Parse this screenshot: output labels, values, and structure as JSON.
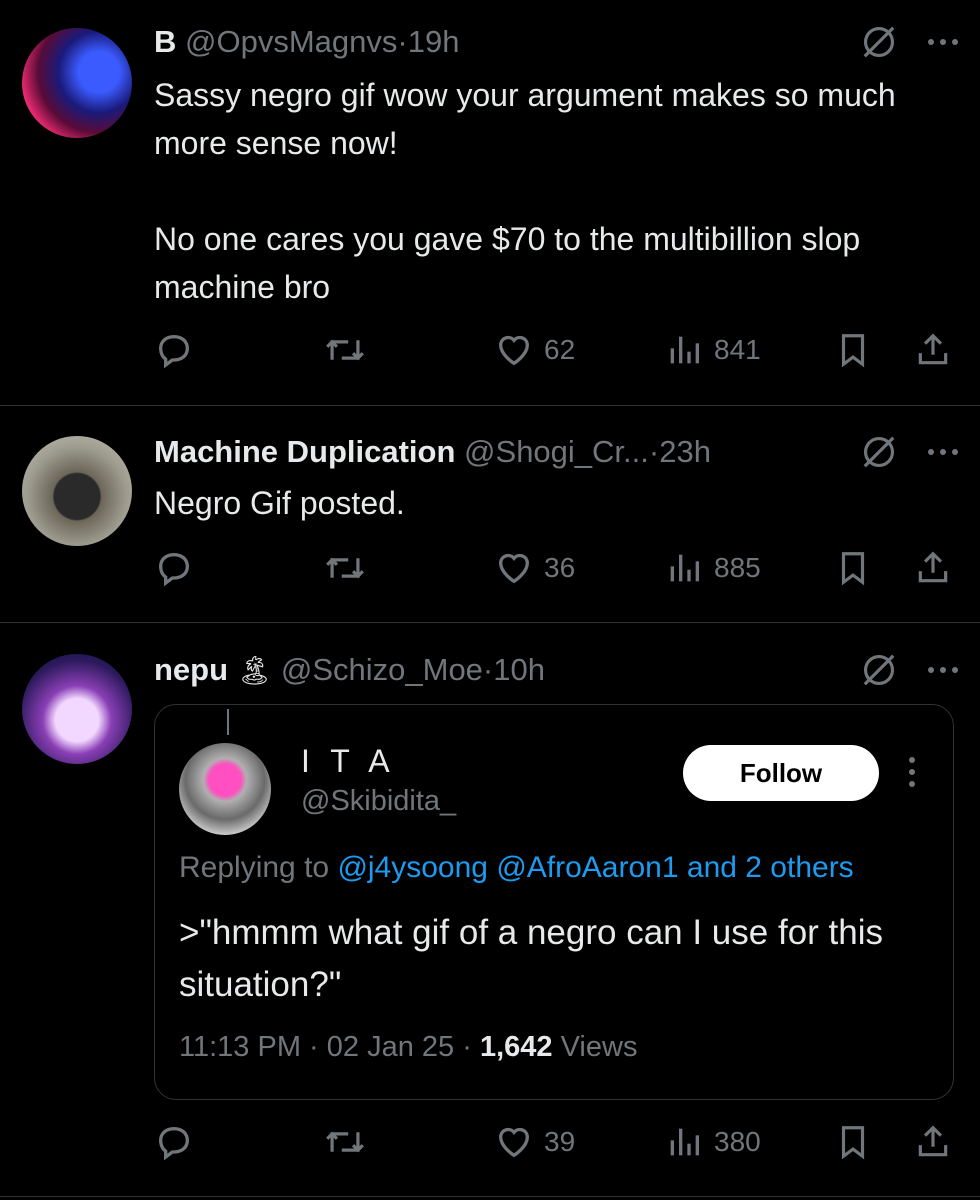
{
  "tweets": [
    {
      "name": "B",
      "handle": "@OpvsMagnvs",
      "sep": "·",
      "time": "19h",
      "text": "Sassy negro gif wow your argument makes so much more sense now!\n\nNo one cares you gave $70 to the multibillion slop machine bro",
      "likes": "62",
      "views": "841"
    },
    {
      "name": "Machine Duplication",
      "handle": "@Shogi_Cr...",
      "sep": "·",
      "time": "23h",
      "text": "Negro Gif posted.",
      "likes": "36",
      "views": "885"
    },
    {
      "name": "nepu",
      "name_emoji": "🏝",
      "handle": "@Schizo_Moe",
      "sep": "·",
      "time": "10h",
      "likes": "39",
      "views": "380"
    }
  ],
  "quote": {
    "name": "I T A",
    "handle": "@Skibidita_",
    "follow_label": "Follow",
    "replying_prefix": "Replying to",
    "reply_1": "@j4ysoong",
    "reply_2": "@AfroAaron1",
    "reply_and": "and 2 others",
    "text": ">\"hmmm what gif of a negro can I use for this situation?\"",
    "time": "11:13 PM",
    "date": "02 Jan 25",
    "views_count": "1,642",
    "views_label": "Views",
    "sep": "·"
  },
  "icons": {
    "reply": "reply-icon",
    "retweet": "retweet-icon",
    "like": "heart-icon",
    "views": "views-icon",
    "bookmark": "bookmark-icon",
    "share": "share-icon",
    "grok": "grok-icon",
    "more": "more-icon"
  },
  "colors": {
    "background": "#000000",
    "text": "#e7e9ea",
    "secondary": "#71767b",
    "link": "#1d9bf0",
    "divider": "#2f3336"
  }
}
